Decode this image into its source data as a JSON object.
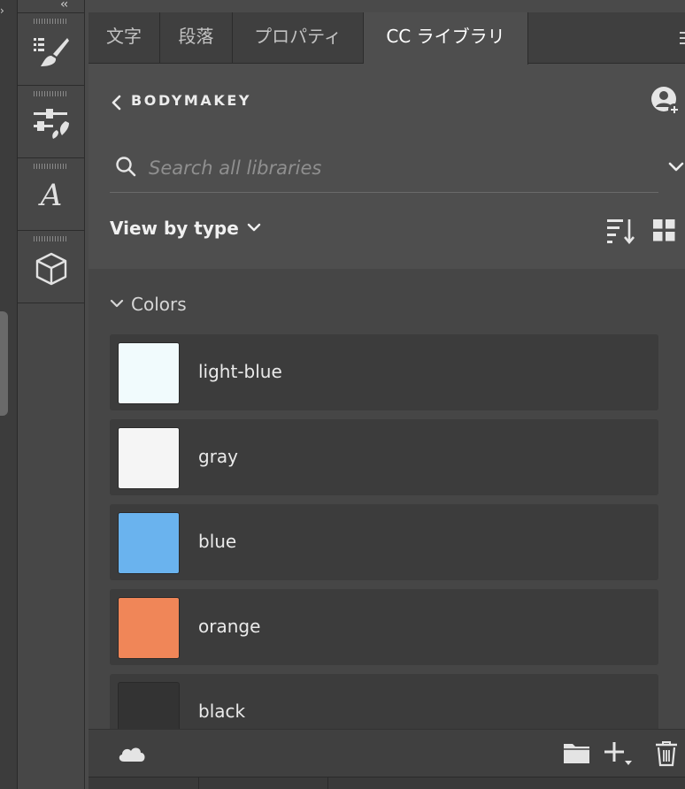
{
  "tool_rail": {
    "collapse": "‹‹",
    "tools": [
      {
        "name": "brush-presets",
        "icon": "brush-list-icon"
      },
      {
        "name": "brush-settings",
        "icon": "brush-sliders-icon"
      },
      {
        "name": "glyphs",
        "icon": "glyphs-icon",
        "glyph": "A"
      },
      {
        "name": "3d",
        "icon": "cube-icon"
      }
    ]
  },
  "tabs": [
    {
      "label": "文字",
      "active": false
    },
    {
      "label": "段落",
      "active": false
    },
    {
      "label": "プロパティ",
      "active": false
    },
    {
      "label": "CC ライブラリ",
      "active": true
    }
  ],
  "library": {
    "name": "BODYMAKEY"
  },
  "search": {
    "placeholder": "Search all libraries",
    "value": ""
  },
  "view": {
    "label": "View by type"
  },
  "section": {
    "title": "Colors"
  },
  "colors": [
    {
      "label": "light-blue",
      "hex": "#f1fbfd"
    },
    {
      "label": "gray",
      "hex": "#f5f5f5"
    },
    {
      "label": "blue",
      "hex": "#6ab3ee"
    },
    {
      "label": "orange",
      "hex": "#f08658"
    },
    {
      "label": "black",
      "hex": "#333333"
    }
  ]
}
